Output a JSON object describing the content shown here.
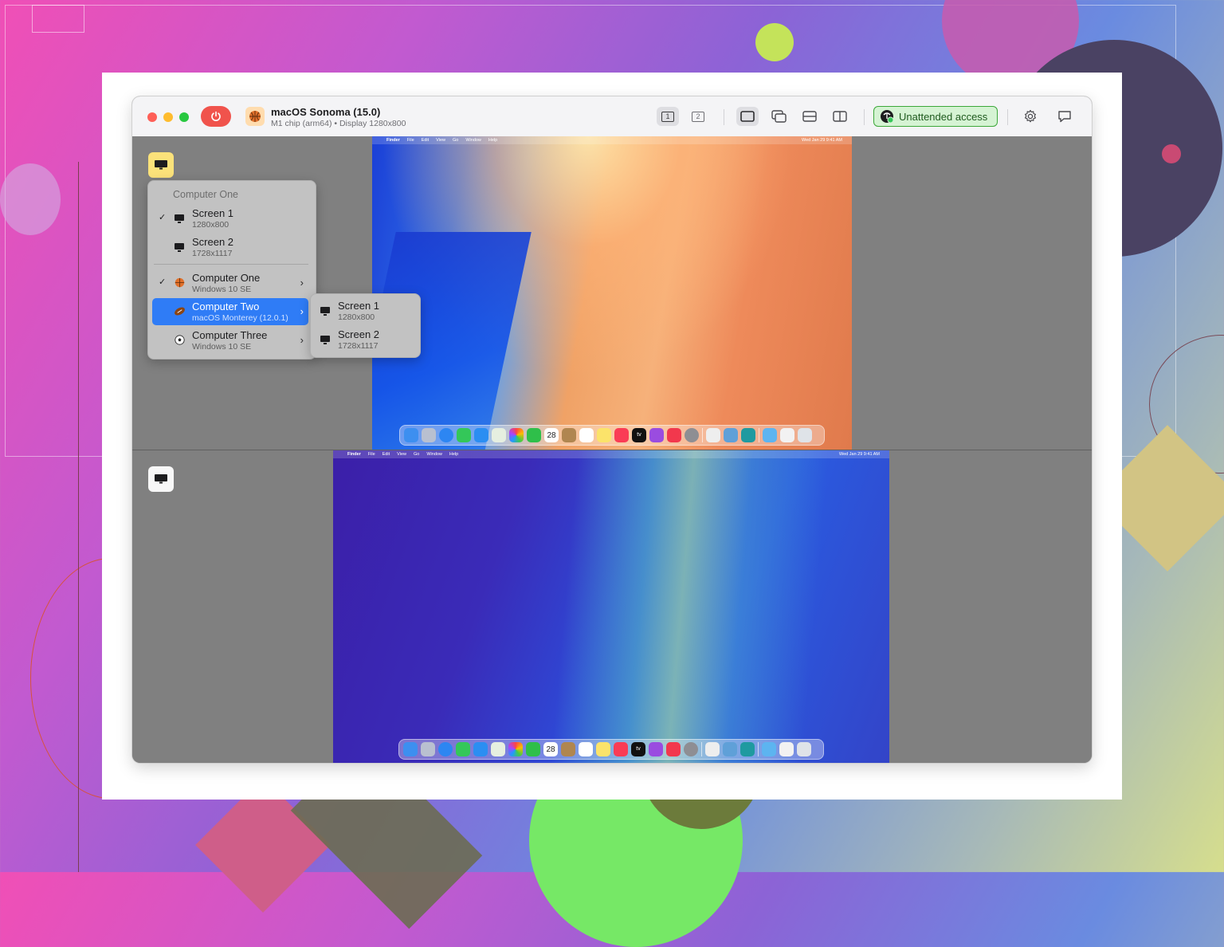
{
  "window": {
    "title": "macOS Sonoma (15.0)",
    "subtitle": "M1 chip (arm64) • Display 1280x800",
    "os_icon": "basketball-icon"
  },
  "toolbar": {
    "display_1_label": "1",
    "display_2_label": "2",
    "unattended_label": "Unattended access",
    "icons": [
      "power-icon",
      "single-view-icon",
      "overlap-view-icon",
      "split-horizontal-icon",
      "split-vertical-icon",
      "gear-icon",
      "chat-icon"
    ]
  },
  "screen_menu": {
    "header": "Computer One",
    "items": [
      {
        "label": "Screen 1",
        "sub": "1280x800",
        "checked": true,
        "icon": "monitor-icon"
      },
      {
        "label": "Screen 2",
        "sub": "1728x1117",
        "checked": false,
        "icon": "monitor-icon"
      },
      {
        "label": "Computer One",
        "sub": "Windows 10 SE",
        "checked": true,
        "icon": "basketball-icon",
        "has_submenu": true
      },
      {
        "label": "Computer Two",
        "sub": "macOS Monterey (12.0.1)",
        "checked": false,
        "icon": "football-icon",
        "has_submenu": true,
        "selected": true
      },
      {
        "label": "Computer Three",
        "sub": "Windows 10 SE",
        "checked": false,
        "icon": "soccer-ball-icon",
        "has_submenu": true
      }
    ],
    "check_glyph": "✓",
    "chevron_glyph": "›"
  },
  "submenu": {
    "items": [
      {
        "label": "Screen 1",
        "sub": "1280x800"
      },
      {
        "label": "Screen 2",
        "sub": "1728x1117"
      }
    ]
  },
  "desktop_top": {
    "menus": [
      "Finder",
      "File",
      "Edit",
      "View",
      "Go",
      "Window",
      "Help"
    ],
    "clock": "Wed Jan 29  9:41 AM"
  },
  "desktop_bottom": {
    "menus": [
      "Finder",
      "File",
      "Edit",
      "View",
      "Go",
      "Window",
      "Help"
    ],
    "clock": "Wed Jan 29  9:41 AM"
  },
  "dock": {
    "calendar_day": "28",
    "tv_label": "tv"
  },
  "colors": {
    "accent_blue": "#2f7cf6",
    "power_red": "#f0534c",
    "unattended_green": "#3da83a",
    "screen_toggle_active": "#fbe27a"
  }
}
